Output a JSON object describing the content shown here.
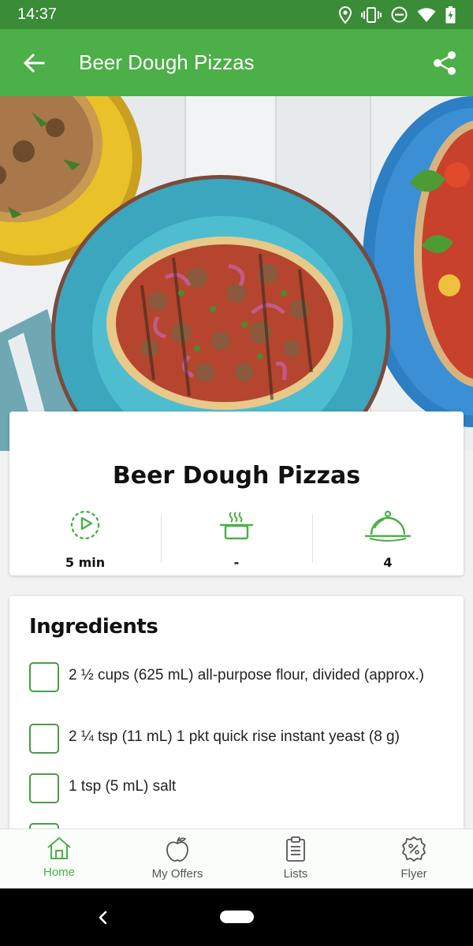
{
  "status_bar": {
    "time": "14:37",
    "icons": [
      "location-icon",
      "vibrate-icon",
      "do-not-disturb-icon",
      "wifi-icon",
      "battery-charging-icon"
    ]
  },
  "app_bar": {
    "title": "Beer Dough Pizzas",
    "back_icon": "arrow-left-icon",
    "share_icon": "share-icon"
  },
  "recipe": {
    "title": "Beer Dough Pizzas",
    "stats": [
      {
        "icon": "timer-icon",
        "value": "5 min"
      },
      {
        "icon": "cooking-pot-icon",
        "value": "-"
      },
      {
        "icon": "serving-dish-icon",
        "value": "4"
      }
    ]
  },
  "ingredients": {
    "title": "Ingredients",
    "items": [
      {
        "text": "2 ½ cups (625 mL) all-purpose flour, divided (approx.)",
        "checked": false
      },
      {
        "text": "2 ¼ tsp (11 mL) 1 pkt quick rise instant yeast (8 g)",
        "checked": false
      },
      {
        "text": "1 tsp (5 mL) salt",
        "checked": false
      }
    ]
  },
  "bottom_nav": {
    "items": [
      {
        "label": "Home",
        "icon": "home-icon",
        "active": true
      },
      {
        "label": "My Offers",
        "icon": "apple-icon",
        "active": false
      },
      {
        "label": "Lists",
        "icon": "clipboard-list-icon",
        "active": false
      },
      {
        "label": "Flyer",
        "icon": "percent-badge-icon",
        "active": false
      }
    ]
  },
  "colors": {
    "brand_green": "#4caf47",
    "status_green": "#3a8c37",
    "checkbox_border": "#4a9c45"
  }
}
